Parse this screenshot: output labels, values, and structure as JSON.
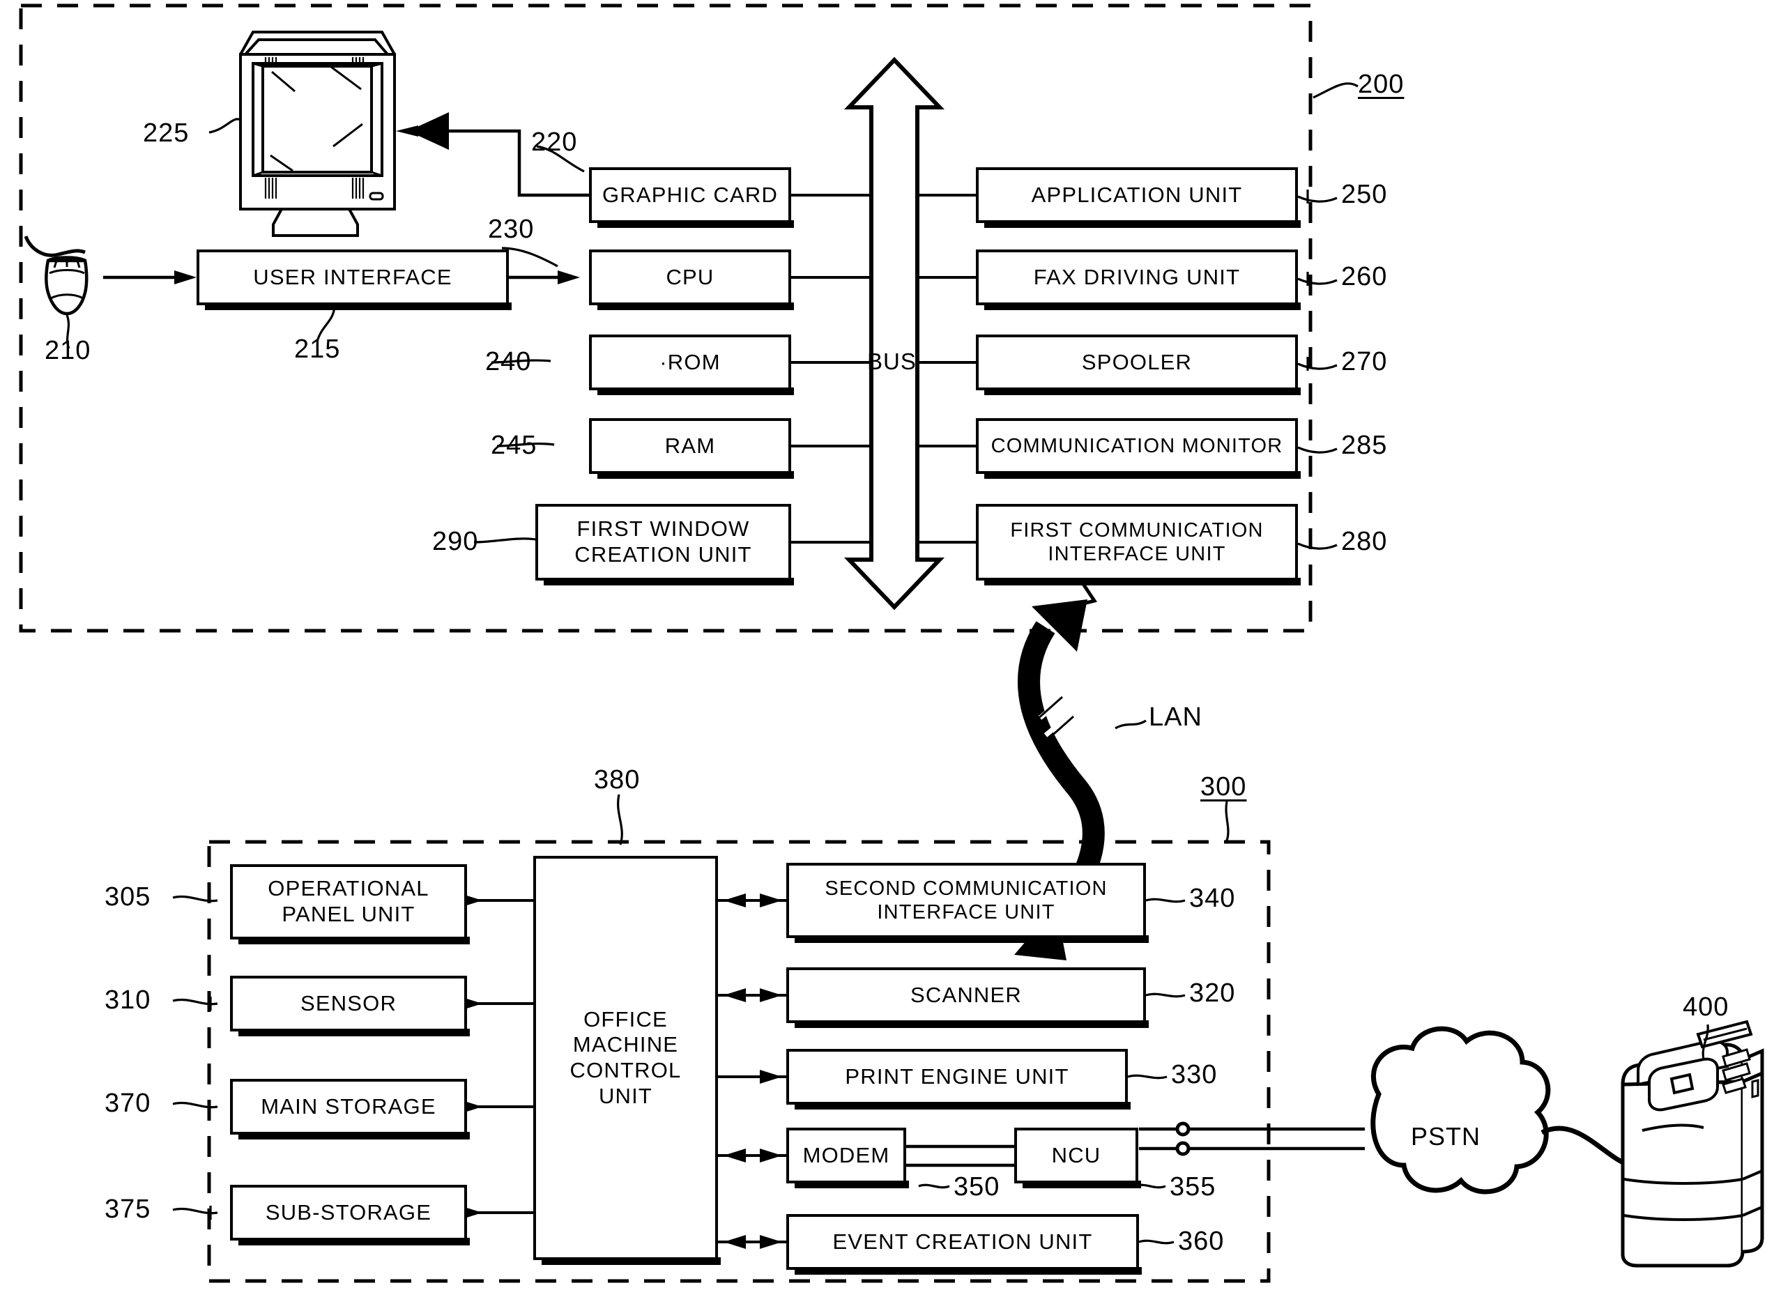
{
  "figure": {
    "type": "patent-block-diagram",
    "host_system": {
      "ref": "200",
      "blocks": [
        {
          "id": "graphic-card",
          "label": "GRAPHIC CARD",
          "ref": "220"
        },
        {
          "id": "user-interface",
          "label": "USER INTERFACE",
          "ref": "215"
        },
        {
          "id": "cpu",
          "label": "CPU",
          "ref": "230"
        },
        {
          "id": "rom",
          "label": "·ROM",
          "ref": "240"
        },
        {
          "id": "ram",
          "label": "RAM",
          "ref": "245"
        },
        {
          "id": "first-window-creation-unit",
          "label": "FIRST WINDOW\nCREATION UNIT",
          "ref": "290"
        },
        {
          "id": "application-unit",
          "label": "APPLICATION UNIT",
          "ref": "250"
        },
        {
          "id": "fax-driving-unit",
          "label": "FAX DRIVING UNIT",
          "ref": "260"
        },
        {
          "id": "spooler",
          "label": "SPOOLER",
          "ref": "270"
        },
        {
          "id": "communication-monitor",
          "label": "COMMUNICATION MONITOR",
          "ref": "285"
        },
        {
          "id": "first-communication-interface-unit",
          "label": "FIRST COMMUNICATION\nINTERFACE UNIT",
          "ref": "280"
        }
      ],
      "bus_label": "BUS",
      "monitor_ref": "225",
      "mouse_ref": "210"
    },
    "network": {
      "lan_label": "LAN"
    },
    "office_machine": {
      "ref": "300",
      "control_unit": {
        "id": "office-machine-control-unit",
        "label": "OFFICE\nMACHINE\nCONTROL\nUNIT",
        "ref": "380"
      },
      "left_blocks": [
        {
          "id": "operational-panel-unit",
          "label": "OPERATIONAL\nPANEL UNIT",
          "ref": "305"
        },
        {
          "id": "sensor",
          "label": "SENSOR",
          "ref": "310"
        },
        {
          "id": "main-storage",
          "label": "MAIN STORAGE",
          "ref": "370"
        },
        {
          "id": "sub-storage",
          "label": "SUB-STORAGE",
          "ref": "375"
        }
      ],
      "right_blocks": [
        {
          "id": "second-communication-interface-unit",
          "label": "SECOND COMMUNICATION\nINTERFACE UNIT",
          "ref": "340"
        },
        {
          "id": "scanner",
          "label": "SCANNER",
          "ref": "320"
        },
        {
          "id": "print-engine-unit",
          "label": "PRINT ENGINE UNIT",
          "ref": "330"
        },
        {
          "id": "modem",
          "label": "MODEM",
          "ref": "350"
        },
        {
          "id": "ncu",
          "label": "NCU",
          "ref": "355"
        },
        {
          "id": "event-creation-unit",
          "label": "EVENT CREATION UNIT",
          "ref": "360"
        }
      ]
    },
    "pstn": {
      "label": "PSTN"
    },
    "remote_fax": {
      "ref": "400"
    }
  },
  "colors": {
    "line": "#000000",
    "background": "#ffffff"
  }
}
